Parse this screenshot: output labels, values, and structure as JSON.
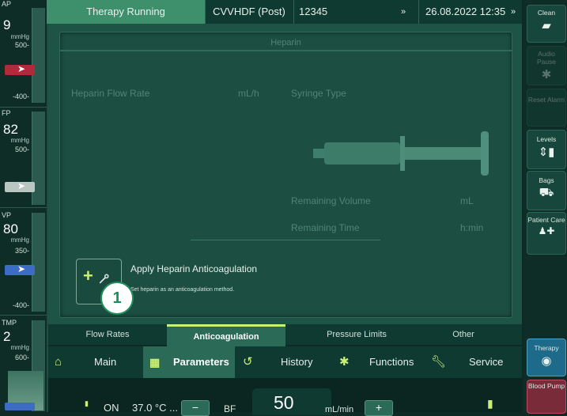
{
  "pressures": {
    "ap": {
      "tag": "AP",
      "value": "9",
      "unit": "mmHg",
      "tick_top": "500-",
      "tick_bottom": "-400-"
    },
    "fp": {
      "tag": "FP",
      "value": "82",
      "unit": "mmHg",
      "tick_top": "500-"
    },
    "vp": {
      "tag": "VP",
      "value": "80",
      "unit": "mmHg",
      "tick_top": "350-",
      "tick_bottom": "-400-"
    },
    "tmp": {
      "tag": "TMP",
      "value": "2",
      "unit": "mmHg",
      "tick_top": "600-"
    }
  },
  "topbar": {
    "status": "Therapy Running",
    "mode": "CVVHDF (Post)",
    "id": "12345",
    "datetime": "26.08.2022 12:35",
    "chevrons": "»"
  },
  "right": {
    "clean": "Clean",
    "audio_pause": "Audio Pause",
    "reset_alarm": "Reset Alarm",
    "levels": "Levels",
    "bags": "Bags",
    "patient_care": "Patient Care",
    "therapy": "Therapy",
    "blood_pump": "Blood Pump"
  },
  "dialog": {
    "title": "Heparin",
    "flow_rate_label": "Heparin Flow Rate",
    "flow_rate_unit": "mL/h",
    "syringe_type_label": "Syringe Type",
    "remaining_volume_label": "Remaining Volume",
    "remaining_volume_unit": "mL",
    "remaining_time_label": "Remaining Time",
    "remaining_time_unit": "h:min",
    "apply_title": "Apply Heparin Anticoagulation",
    "apply_desc": "Set heparin as an anticoagulation method.",
    "callout": "1"
  },
  "tabs": [
    "Flow Rates",
    "Anticoagulation",
    "Pressure Limits",
    "Other"
  ],
  "nav": {
    "main": "Main",
    "parameters": "Parameters",
    "history": "History",
    "functions": "Functions",
    "service": "Service"
  },
  "bottom": {
    "on": "ON",
    "temp": "37.0 °C ...",
    "bf": "BF",
    "bf_value": "50",
    "bf_unit": "mL/min",
    "minus": "−",
    "plus": "+"
  },
  "colors": {
    "accent": "#c8f07a",
    "panel": "#1e5446",
    "selected_tab": "#2a6a57"
  }
}
